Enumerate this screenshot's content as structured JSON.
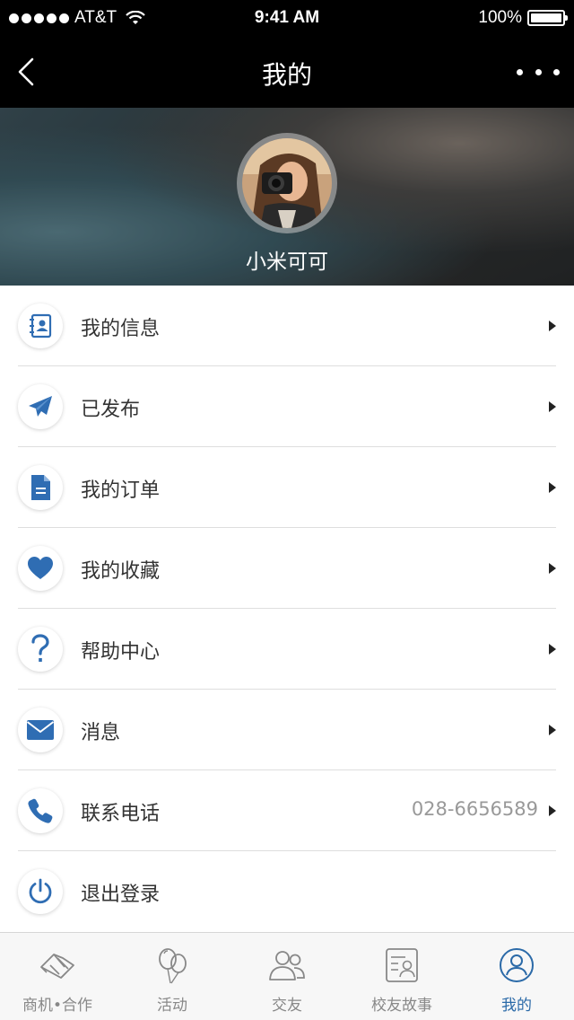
{
  "status_bar": {
    "carrier": "AT&T",
    "time": "9:41 AM",
    "battery": "100%"
  },
  "nav": {
    "title": "我的"
  },
  "profile": {
    "name": "小米可可"
  },
  "menu": [
    {
      "label": "我的信息",
      "icon": "contact-card-icon",
      "value": ""
    },
    {
      "label": "已发布",
      "icon": "paper-plane-icon",
      "value": ""
    },
    {
      "label": "我的订单",
      "icon": "document-icon",
      "value": ""
    },
    {
      "label": "我的收藏",
      "icon": "heart-icon",
      "value": ""
    },
    {
      "label": "帮助中心",
      "icon": "question-icon",
      "value": ""
    },
    {
      "label": "消息",
      "icon": "envelope-icon",
      "value": ""
    },
    {
      "label": "联系电话",
      "icon": "phone-icon",
      "value": "028-6656589"
    },
    {
      "label": "退出登录",
      "icon": "power-icon",
      "value": ""
    }
  ],
  "tabs": [
    {
      "label": "商机•合作",
      "icon": "handshake-icon",
      "active": false
    },
    {
      "label": "活动",
      "icon": "balloons-icon",
      "active": false
    },
    {
      "label": "交友",
      "icon": "friends-icon",
      "active": false
    },
    {
      "label": "校友故事",
      "icon": "story-card-icon",
      "active": false
    },
    {
      "label": "我的",
      "icon": "user-circle-icon",
      "active": true
    }
  ],
  "colors": {
    "accent": "#2b6aa8",
    "nav_bg": "#000000",
    "icon_blue": "#2f6db3"
  }
}
